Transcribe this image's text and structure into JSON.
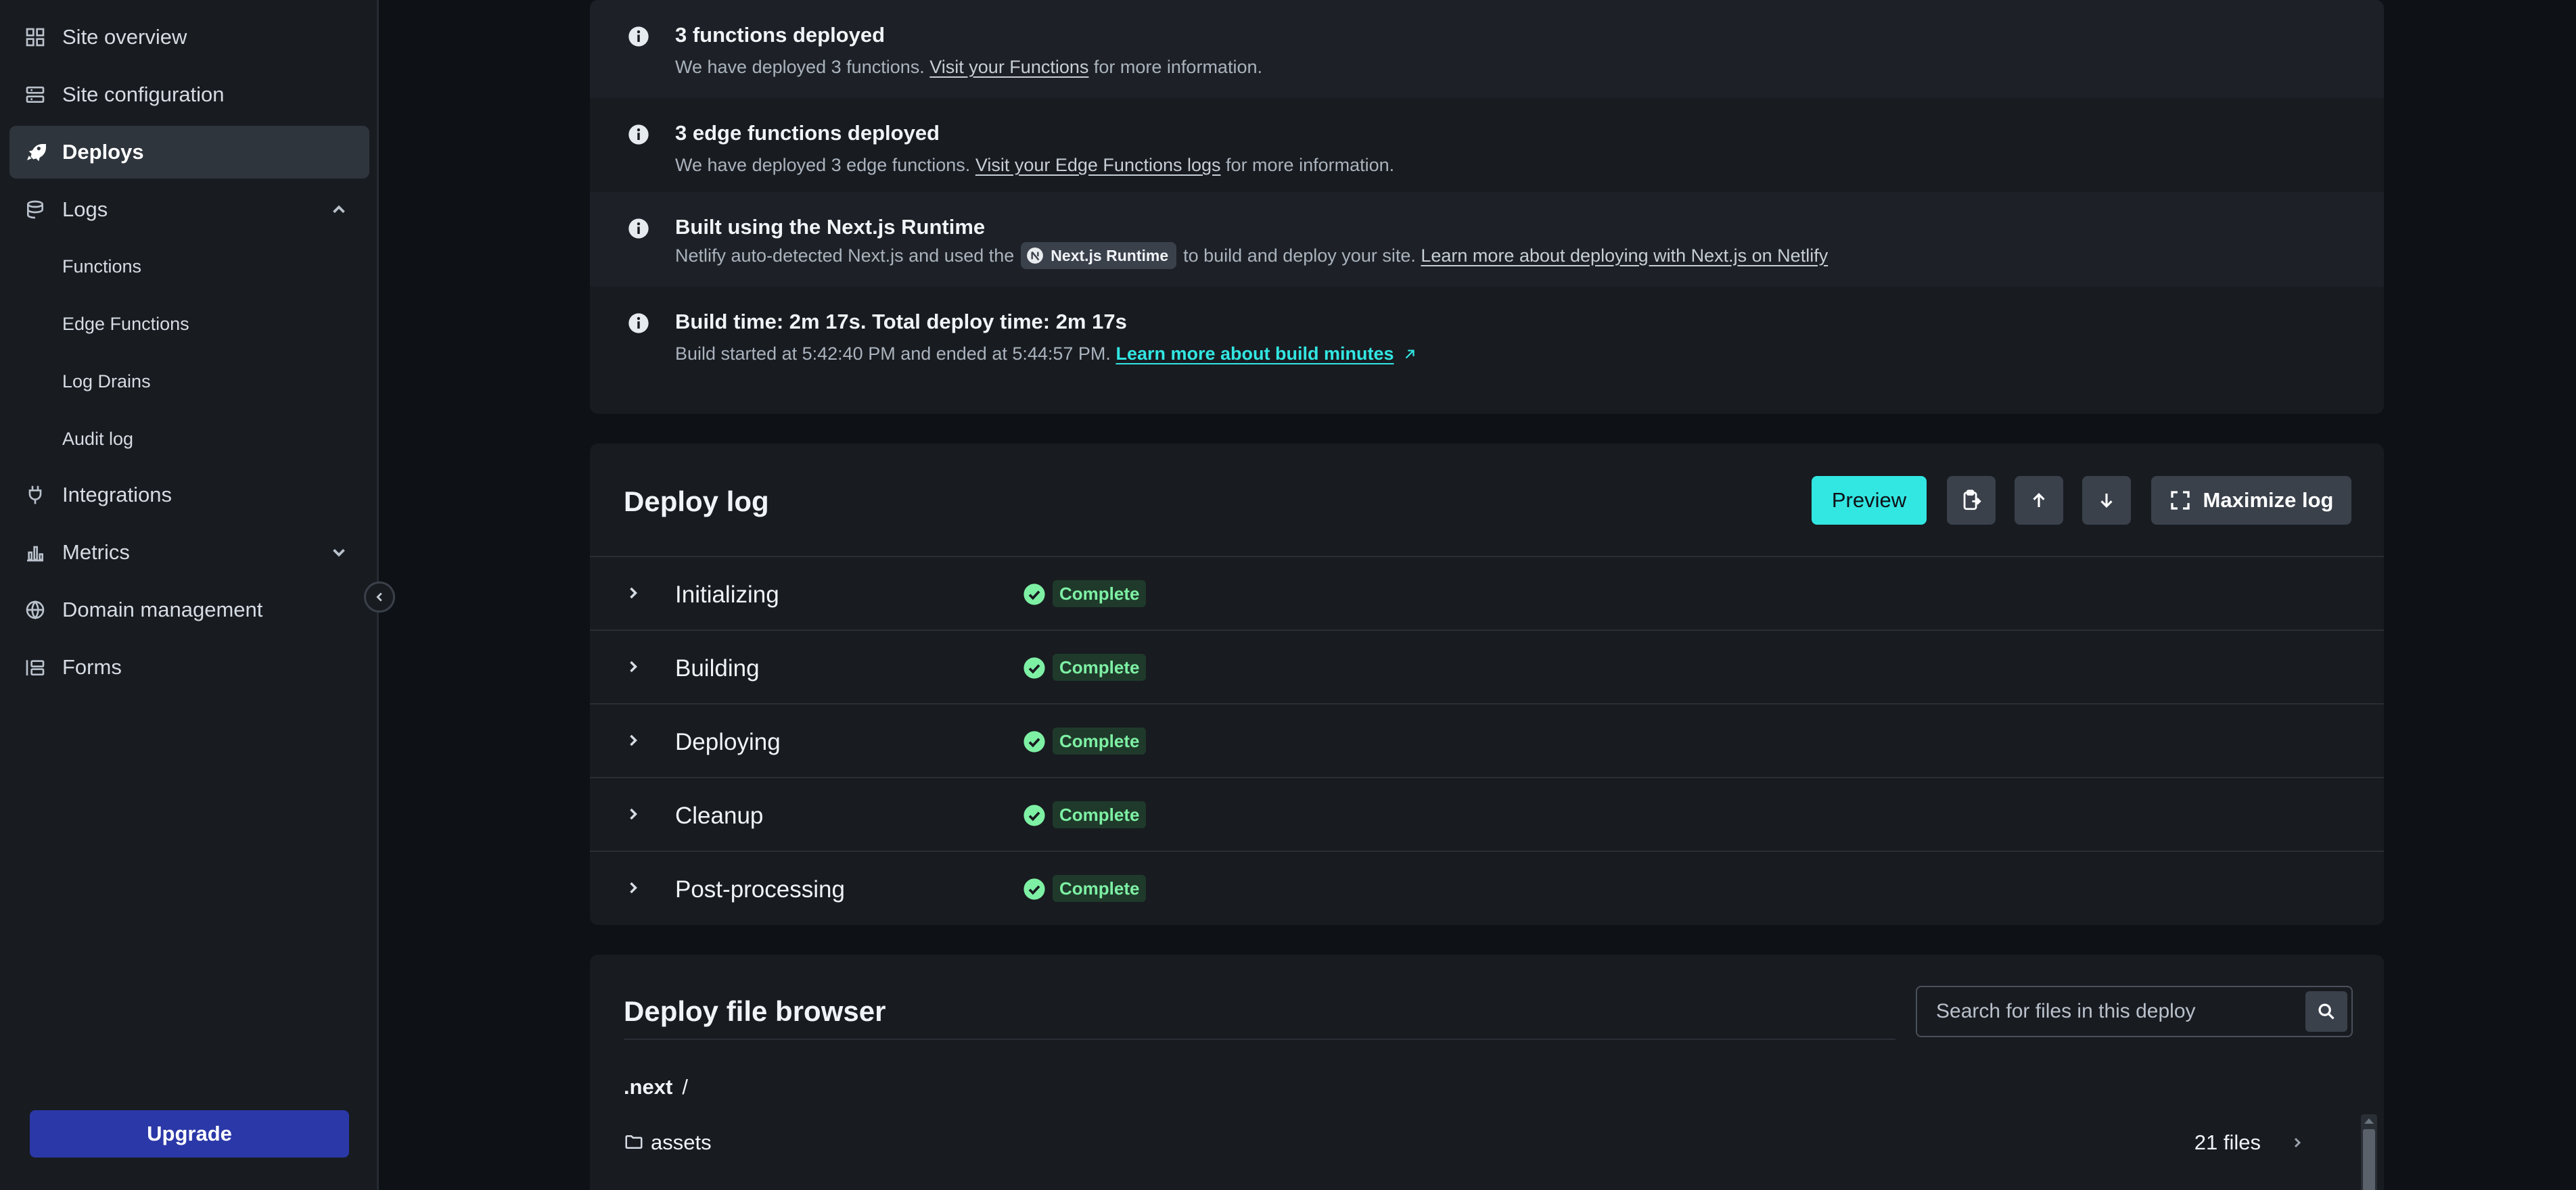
{
  "sidebar": {
    "items": [
      {
        "label": "Site overview",
        "icon": "grid-icon"
      },
      {
        "label": "Site configuration",
        "icon": "sliders-icon"
      },
      {
        "label": "Deploys",
        "icon": "rocket-icon",
        "active": true
      },
      {
        "label": "Logs",
        "icon": "logs-icon",
        "expanded": true
      },
      {
        "label": "Integrations",
        "icon": "plug-icon"
      },
      {
        "label": "Metrics",
        "icon": "bar-chart-icon",
        "expanded": false
      },
      {
        "label": "Domain management",
        "icon": "globe-icon"
      },
      {
        "label": "Forms",
        "icon": "form-icon"
      }
    ],
    "logs_children": [
      "Functions",
      "Edge Functions",
      "Log Drains",
      "Audit log"
    ],
    "upgrade_label": "Upgrade"
  },
  "summary": {
    "items": [
      {
        "title": "3 functions deployed",
        "desc_before": "We have deployed 3 functions.",
        "link": "Visit your Functions",
        "desc_after": "for more information."
      },
      {
        "title": "3 edge functions deployed",
        "desc_before": "We have deployed 3 edge functions.",
        "link": "Visit your Edge Functions logs",
        "desc_after": "for more information."
      },
      {
        "title": "Built using the Next.js Runtime",
        "desc_before": "Netlify auto-detected Next.js and used the",
        "pill": "Next.js Runtime",
        "desc_middle": "to build and deploy your site.",
        "link": "Learn more about deploying with Next.js on Netlify"
      },
      {
        "title": "Build time: 2m 17s. Total deploy time: 2m 17s",
        "desc_before": "Build started at 5:42:40 PM and ended at 5:44:57 PM.",
        "link": "Learn more about build minutes"
      }
    ]
  },
  "deploy_log": {
    "title": "Deploy log",
    "preview_label": "Preview",
    "maximize_label": "Maximize log",
    "steps": [
      {
        "name": "Initializing",
        "status": "Complete"
      },
      {
        "name": "Building",
        "status": "Complete"
      },
      {
        "name": "Deploying",
        "status": "Complete"
      },
      {
        "name": "Cleanup",
        "status": "Complete"
      },
      {
        "name": "Post-processing",
        "status": "Complete"
      }
    ]
  },
  "file_browser": {
    "title": "Deploy file browser",
    "search_placeholder": "Search for files in this deploy",
    "path": ".next",
    "path_sep": "/",
    "files": [
      {
        "name": "assets",
        "count": "21 files"
      }
    ]
  },
  "colors": {
    "accent": "#32e6e2",
    "upgrade": "#2b38a8",
    "success": "#7ef0a4"
  }
}
